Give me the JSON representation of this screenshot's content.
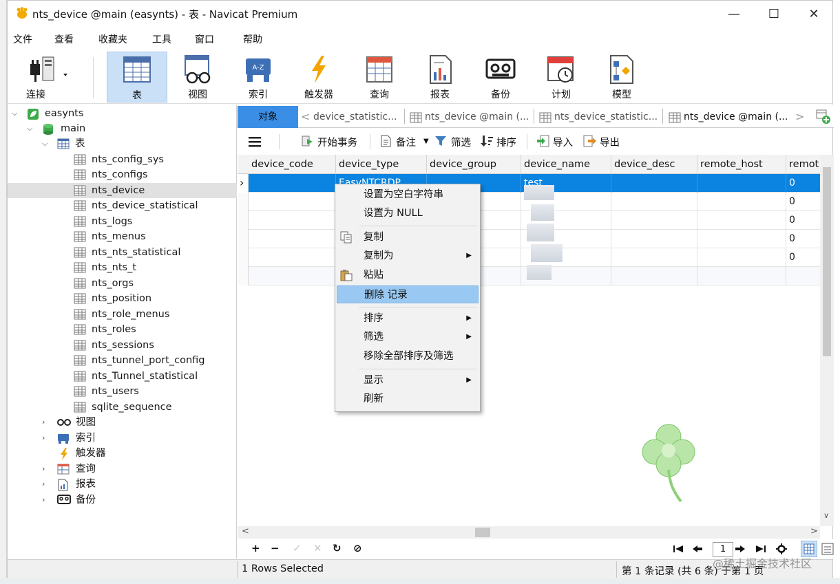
{
  "window": {
    "title": "nts_device @main (easynts) - 表 - Navicat Premium",
    "minimize": "—",
    "maximize": "☐",
    "close": "✕"
  },
  "menu": [
    "文件",
    "查看",
    "收藏夹",
    "工具",
    "窗口",
    "帮助"
  ],
  "toolbar": {
    "items": [
      {
        "label": "连接",
        "icon": "plug-icon"
      },
      {
        "label": "表",
        "icon": "table-icon",
        "active": true
      },
      {
        "label": "视图",
        "icon": "view-glasses-icon"
      },
      {
        "label": "索引",
        "icon": "index-icon"
      },
      {
        "label": "触发器",
        "icon": "lightning-icon"
      },
      {
        "label": "查询",
        "icon": "query-icon"
      },
      {
        "label": "报表",
        "icon": "report-icon"
      },
      {
        "label": "备份",
        "icon": "backup-tape-icon"
      },
      {
        "label": "计划",
        "icon": "calendar-clock-icon"
      },
      {
        "label": "模型",
        "icon": "model-icon"
      }
    ]
  },
  "tree": {
    "connection": "easynts",
    "database": "main",
    "tables_group": "表",
    "tables": [
      "nts_config_sys",
      "nts_configs",
      "nts_device",
      "nts_device_statistical",
      "nts_logs",
      "nts_menus",
      "nts_nts_statistical",
      "nts_nts_t",
      "nts_orgs",
      "nts_position",
      "nts_role_menus",
      "nts_roles",
      "nts_sessions",
      "nts_tunnel_port_config",
      "nts_Tunnel_statistical",
      "nts_users",
      "sqlite_sequence"
    ],
    "selected_table": "nts_device",
    "other_groups": [
      "视图",
      "索引",
      "触发器",
      "查询",
      "报表",
      "备份"
    ]
  },
  "tabs": {
    "objects": "对象",
    "items": [
      "device_statistic...",
      "nts_device @main (...",
      "nts_device_statistic...",
      "nts_device @main (..."
    ],
    "back": "<",
    "forward": ">"
  },
  "objtoolbar": {
    "begin_tx": "开始事务",
    "note": "备注",
    "filter": "筛选",
    "sort": "排序",
    "import": "导入",
    "export": "导出"
  },
  "grid": {
    "columns": [
      "device_code",
      "device_type",
      "device_group",
      "device_name",
      "device_desc",
      "remote_host",
      "remot"
    ],
    "rows": [
      [
        "",
        "EasyNTCRDP",
        "",
        "test",
        "",
        "",
        "0"
      ],
      [
        "",
        "",
        "",
        "",
        "",
        "",
        "0"
      ],
      [
        "",
        "",
        "",
        "",
        "",
        "",
        "0"
      ],
      [
        "",
        "",
        "",
        "",
        "",
        "",
        "0"
      ],
      [
        "",
        "",
        "",
        "",
        "",
        "",
        "0"
      ],
      [
        "",
        "",
        "",
        "",
        "",
        "",
        ""
      ]
    ],
    "row_indicator": "›"
  },
  "context_menu": {
    "items": [
      {
        "label": "设置为空白字符串"
      },
      {
        "label": "设置为 NULL"
      },
      {
        "label": "复制",
        "icon": "copy-icon"
      },
      {
        "label": "复制为",
        "submenu": true
      },
      {
        "label": "粘贴",
        "icon": "paste-icon"
      },
      {
        "label": "删除 记录",
        "highlighted": true
      },
      {
        "label": "排序",
        "submenu": true
      },
      {
        "label": "筛选",
        "submenu": true
      },
      {
        "label": "移除全部排序及筛选"
      },
      {
        "label": "显示",
        "submenu": true
      },
      {
        "label": "刷新"
      }
    ]
  },
  "nav": {
    "page": "1",
    "add": "+",
    "remove": "−",
    "apply": "✓",
    "discard": "✕",
    "refresh": "↻",
    "stop": "⊘"
  },
  "status": {
    "left": "1 Rows Selected",
    "right": "第 1 条记录 (共 6 条) 于第 1 页"
  },
  "watermark": "@稀土掘金技术社区",
  "colors": {
    "selection": "#0a84e0",
    "active_tool": "#c9e0f7",
    "menu_highlight": "#99c9f3",
    "objects_tab": "#3a8ee6"
  }
}
